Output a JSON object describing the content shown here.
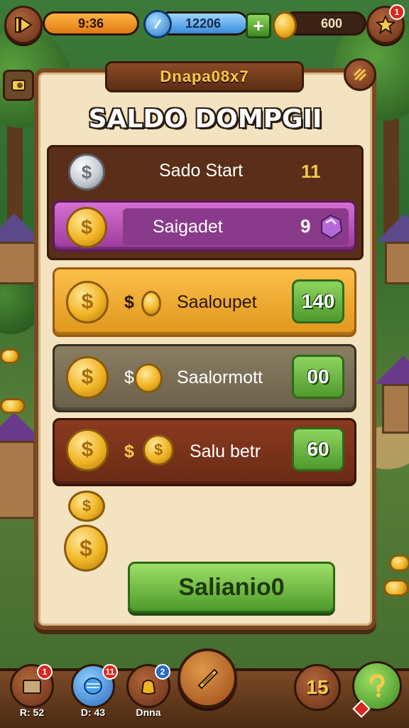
{
  "hud": {
    "energy_value": "9:36",
    "gems_value": "12206",
    "coins_value": "600",
    "notif_count": "1"
  },
  "panel": {
    "tab_text": "Dnapa08x7",
    "title": "SALDO DOMPGII"
  },
  "rows": [
    {
      "label": "Sado Start",
      "value": "11"
    },
    {
      "label": "Saigadet",
      "value": "9"
    }
  ],
  "offers": [
    {
      "price": "$",
      "label": "Saaloupet",
      "value": "140"
    },
    {
      "price": "$",
      "label": "Saalormott",
      "value": "00"
    },
    {
      "price": "$",
      "label": "Salu betr",
      "value": "60"
    }
  ],
  "main_button": "Salianio0",
  "bottom_nav": [
    {
      "label": "R: 52",
      "badge": "1"
    },
    {
      "label": "D: 43",
      "badge": "11"
    },
    {
      "label": "Dnna",
      "badge": "2"
    },
    {
      "label": "",
      "badge": ""
    },
    {
      "label": "15",
      "badge": ""
    },
    {
      "label": "",
      "badge": ""
    }
  ]
}
